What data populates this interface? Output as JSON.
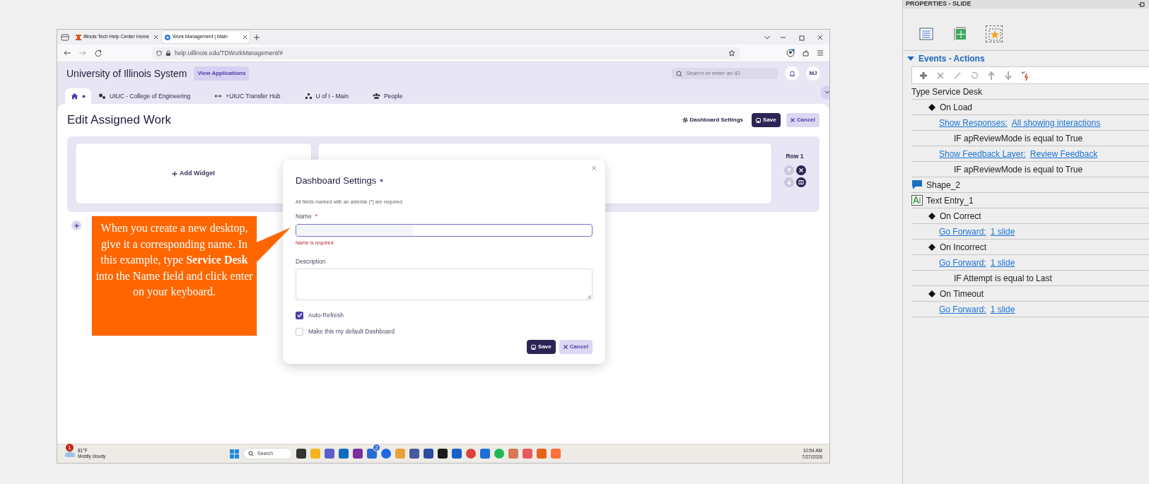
{
  "browser": {
    "tabs": [
      {
        "title": "Illinois Tech Help Center Home",
        "selected": false
      },
      {
        "title": "Work Management | Main",
        "selected": true
      }
    ],
    "url": "help.uillinois.edu/TDWorkManagement/#"
  },
  "app": {
    "title": "University of Illinois System",
    "apps_button": "View Applications",
    "search": {
      "placeholder": "Search or enter an ID"
    },
    "avatar": "MJ",
    "nav": [
      {
        "kind": "home",
        "selected": true
      },
      {
        "kind": "link",
        "label": "UIUC - College of Engineering",
        "selected": false
      },
      {
        "kind": "link",
        "label": "+UIUC Transfer Hub",
        "selected": false
      },
      {
        "kind": "link",
        "label": "U of I - Main",
        "selected": false
      },
      {
        "kind": "link",
        "label": "People",
        "selected": false
      }
    ]
  },
  "page": {
    "title": "Edit Assigned Work",
    "settings_link": "Dashboard Settings",
    "save": "Save",
    "cancel": "Cancel",
    "add_widget": "Add Widget",
    "row_label": "Row 1"
  },
  "dialog": {
    "title": "Dashboard Settings",
    "note": "All fields marked with an asterisk (*) are required.",
    "fields": [
      {
        "kind": "input",
        "label": "Name",
        "required_mark": "*",
        "error": "Name is required."
      },
      {
        "kind": "textarea",
        "label": "Description"
      }
    ],
    "checkboxes": [
      {
        "label": "Auto-Refresh",
        "checked": true
      },
      {
        "label": "Make this my default Dashboard",
        "checked": false
      }
    ],
    "save": "Save",
    "cancel": "Cancel"
  },
  "callout": "When you create a new desktop, give it a corresponding name. In this example, type **Service Desk** into the Name field and click enter on your keyboard.",
  "taskbar": {
    "weather": {
      "badge": "1",
      "temperature": "81°F",
      "condition": "Mostly cloudy"
    },
    "search": {
      "placeholder": "Search"
    },
    "app_badge": "2",
    "time": "10:54 AM",
    "date": "7/27/2026"
  },
  "properties_panel": {
    "title": "PROPERTIES - SLIDE",
    "view_tabs": [
      {
        "selected": false
      },
      {
        "selected": false
      },
      {
        "selected": true
      }
    ],
    "section": {
      "title": "Events - Actions",
      "expanded": true
    },
    "tree": [
      {
        "kind": "slide",
        "label": "Type Service Desk",
        "children": [
          {
            "kind": "event",
            "label": "On Load",
            "children": [
              {
                "kind": "action",
                "action": "Show Responses:",
                "target": "All showing interactions",
                "children": [
                  {
                    "kind": "condition",
                    "label": "IF apReviewMode is equal to True"
                  }
                ]
              },
              {
                "kind": "action",
                "action": "Show Feedback Layer:",
                "target": "Review Feedback",
                "children": [
                  {
                    "kind": "condition",
                    "label": "IF apReviewMode is equal to True"
                  }
                ]
              }
            ]
          }
        ]
      },
      {
        "kind": "shape",
        "label": "Shape_2"
      },
      {
        "kind": "text_entry",
        "label": "Text Entry_1",
        "children": [
          {
            "kind": "event",
            "label": "On Correct",
            "children": [
              {
                "kind": "action",
                "action": "Go Forward:",
                "target": "1 slide"
              }
            ]
          },
          {
            "kind": "event",
            "label": "On Incorrect",
            "children": [
              {
                "kind": "action",
                "action": "Go Forward:",
                "target": "1 slide",
                "children": [
                  {
                    "kind": "condition",
                    "label": "IF Attempt is equal to Last"
                  }
                ]
              }
            ]
          },
          {
            "kind": "event",
            "label": "On Timeout",
            "children": [
              {
                "kind": "action",
                "action": "Go Forward:",
                "target": "1 slide"
              }
            ]
          }
        ]
      }
    ]
  }
}
